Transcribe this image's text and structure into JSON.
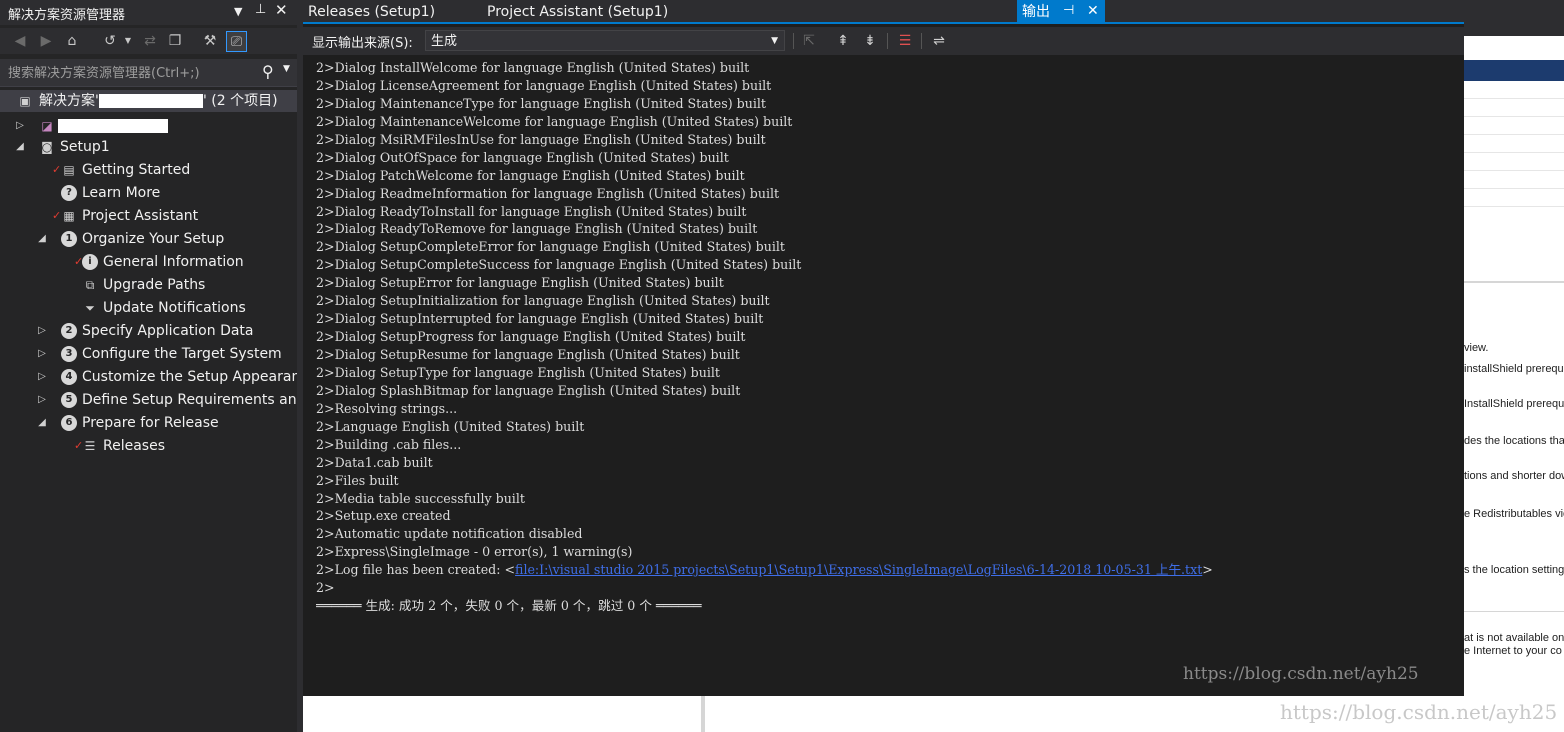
{
  "solution_explorer": {
    "title": "解决方案资源管理器",
    "search_placeholder": "搜索解决方案资源管理器(Ctrl+;)",
    "solution_row": {
      "prefix": "解决方案'",
      "suffix": "' (2 个项目)"
    },
    "setup_project": "Setup1",
    "items": {
      "getting_started": "Getting Started",
      "learn_more": "Learn More",
      "project_assistant": "Project Assistant",
      "organize": "Organize Your Setup",
      "general_info": "General Information",
      "upgrade_paths": "Upgrade Paths",
      "update_notifications": "Update Notifications",
      "specify_app_data": "Specify Application Data",
      "configure_target": "Configure the Target System",
      "customize_appearance": "Customize the Setup Appearance",
      "define_requirements": "Define Setup Requirements and",
      "prepare_release": "Prepare for Release",
      "releases": "Releases"
    },
    "badges": {
      "organize": "1",
      "specify": "2",
      "configure": "3",
      "customize": "4",
      "define": "5",
      "prepare": "6"
    }
  },
  "tabs": {
    "releases": "Releases (Setup1)",
    "project_assistant": "Project Assistant (Setup1)",
    "output": "输出"
  },
  "output": {
    "source_label": "显示输出来源(S):",
    "source_value": "生成",
    "lines": [
      "2>Dialog InstallWelcome for language English (United States) built",
      "2>Dialog LicenseAgreement for language English (United States) built",
      "2>Dialog MaintenanceType for language English (United States) built",
      "2>Dialog MaintenanceWelcome for language English (United States) built",
      "2>Dialog MsiRMFilesInUse for language English (United States) built",
      "2>Dialog OutOfSpace for language English (United States) built",
      "2>Dialog PatchWelcome for language English (United States) built",
      "2>Dialog ReadmeInformation for language English (United States) built",
      "2>Dialog ReadyToInstall for language English (United States) built",
      "2>Dialog ReadyToRemove for language English (United States) built",
      "2>Dialog SetupCompleteError for language English (United States) built",
      "2>Dialog SetupCompleteSuccess for language English (United States) built",
      "2>Dialog SetupError for language English (United States) built",
      "2>Dialog SetupInitialization for language English (United States) built",
      "2>Dialog SetupInterrupted for language English (United States) built",
      "2>Dialog SetupProgress for language English (United States) built",
      "2>Dialog SetupResume for language English (United States) built",
      "2>Dialog SetupType for language English (United States) built",
      "2>Dialog SplashBitmap for language English (United States) built",
      "2>Resolving strings...",
      "2>Language English (United States) built",
      "2>Building .cab files...",
      "2>Data1.cab built",
      "2>Files built",
      "2>Media table successfully built",
      "2>Setup.exe created",
      "2>Automatic update notification disabled",
      "2>Express\\SingleImage - 0 error(s), 1 warning(s)"
    ],
    "log_prefix": "2>Log file has been created: <",
    "log_link": "file:I:\\visual studio 2015 projects\\Setup1\\Setup1\\Express\\SingleImage\\LogFiles\\6-14-2018 10-05-31 上午.txt",
    "log_suffix": ">",
    "prompt": "2>",
    "summary": "══════ 生成: 成功 2 个，失败 0 个，最新 0 个，跳过 0 个 ══════"
  },
  "watermark": "https://blog.csdn.net/ayh25",
  "background_designer": {
    "snippets": [
      "view.",
      "installShield prerequisi",
      " InstallShield prerequ",
      "des the locations tha",
      "tions and shorter dow",
      "e Redistributables vie",
      "s the location setting",
      "at is not available on",
      "e Internet to your co"
    ]
  }
}
